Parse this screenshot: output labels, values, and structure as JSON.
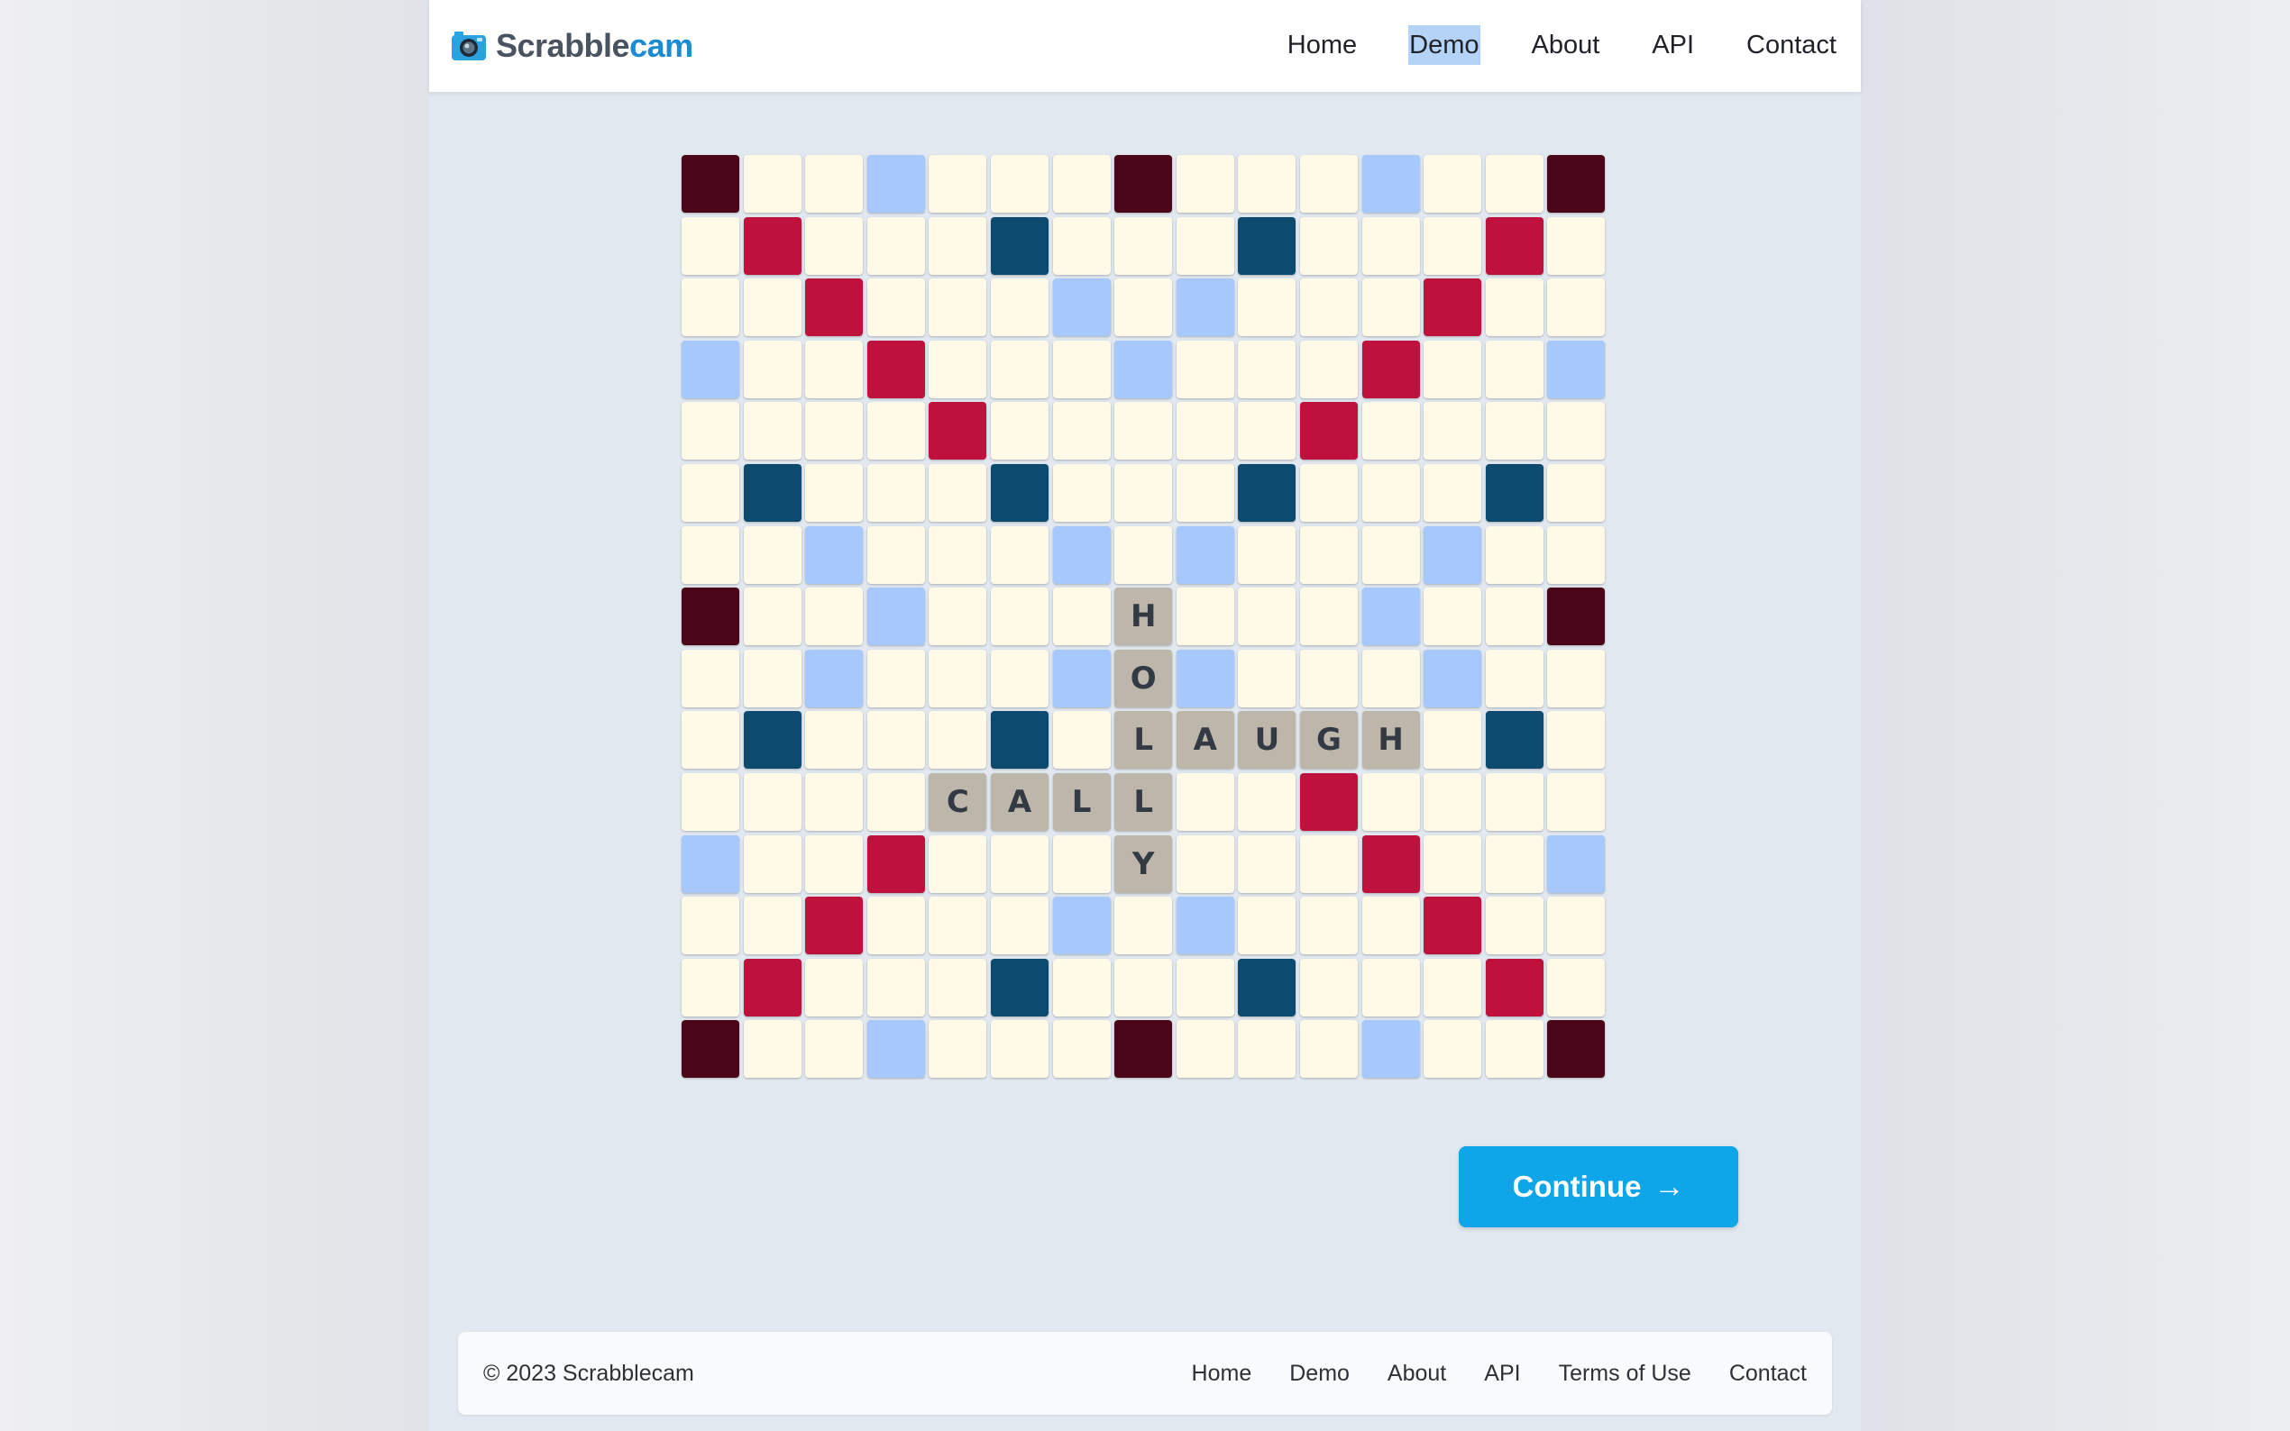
{
  "brand": {
    "name_part1": "Scrabble",
    "name_part2": "cam",
    "icon": "camera-icon",
    "accent_color": "#1b8bd3"
  },
  "nav": {
    "items": [
      {
        "label": "Home",
        "active": false
      },
      {
        "label": "Demo",
        "active": true
      },
      {
        "label": "About",
        "active": false
      },
      {
        "label": "API",
        "active": false
      },
      {
        "label": "Contact",
        "active": false
      }
    ]
  },
  "board": {
    "size": 15,
    "colors": {
      "N": "#fff9e8",
      "TW": "#4b0619",
      "DW": "#be123c",
      "TL": "#0c4a6e",
      "DL": "#a6c8fb",
      "tile": "#bdb6ab"
    },
    "layout": [
      "TW N N DL N N N TW N N N DL N N TW",
      "N DW N N N TL N N N TL N N N DW N",
      "N N DW N N N DL N DL N N N DW N N",
      "DL N N DW N N N DL N N N DW N N DL",
      "N N N N DW N N N N N DW N N N N",
      "N TL N N N TL N N N TL N N N TL N",
      "N N DL N N N DL N DL N N N DL N N",
      "TW N N DL N N N N N N N DL N N TW",
      "N N DL N N N DL N DL N N N DL N N",
      "N TL N N N TL N N N N N N N TL N",
      "N N N N N N N N N N DW N N N N",
      "DL N N DW N N N N N N N DW N N DL",
      "N N DW N N N DL N DL N N N DW N N",
      "N DW N N N TL N N N TL N N N DW N",
      "TW N N DL N N N TW N N N DL N N TW"
    ],
    "tiles": [
      {
        "row": 7,
        "col": 7,
        "letter": "H"
      },
      {
        "row": 8,
        "col": 7,
        "letter": "O"
      },
      {
        "row": 9,
        "col": 7,
        "letter": "L"
      },
      {
        "row": 9,
        "col": 8,
        "letter": "A"
      },
      {
        "row": 9,
        "col": 9,
        "letter": "U"
      },
      {
        "row": 9,
        "col": 10,
        "letter": "G"
      },
      {
        "row": 9,
        "col": 11,
        "letter": "H"
      },
      {
        "row": 10,
        "col": 4,
        "letter": "C"
      },
      {
        "row": 10,
        "col": 5,
        "letter": "A"
      },
      {
        "row": 10,
        "col": 6,
        "letter": "L"
      },
      {
        "row": 10,
        "col": 7,
        "letter": "L"
      },
      {
        "row": 11,
        "col": 7,
        "letter": "Y"
      }
    ]
  },
  "continue_button": {
    "label": "Continue",
    "icon": "arrow-right-icon",
    "glyph": "→",
    "color": "#0ea5e9"
  },
  "footer": {
    "copyright": "© 2023 Scrabblecam",
    "links": [
      "Home",
      "Demo",
      "About",
      "API",
      "Terms of Use",
      "Contact"
    ]
  }
}
